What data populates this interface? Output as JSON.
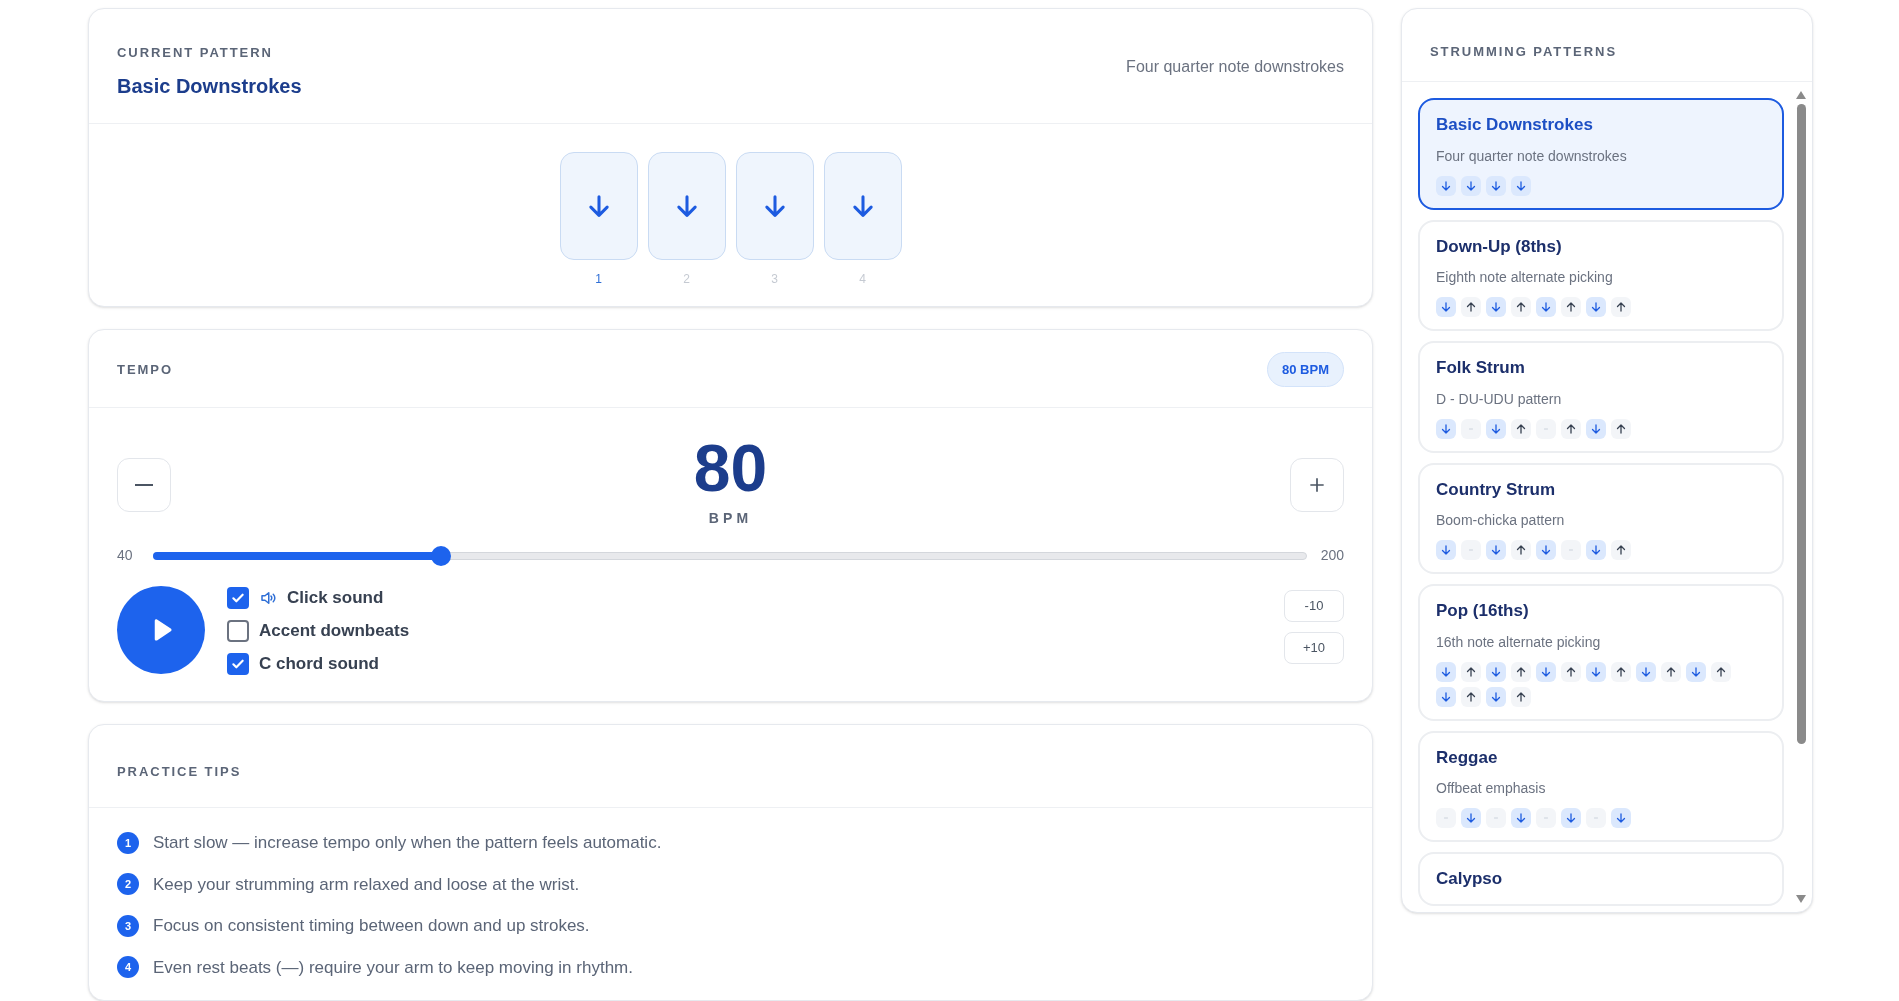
{
  "current_pattern": {
    "label": "CURRENT PATTERN",
    "title": "Basic Downstrokes",
    "description": "Four quarter note downstrokes",
    "beats": [
      {
        "kind": "down",
        "number": "1",
        "active": true
      },
      {
        "kind": "down",
        "number": "2",
        "active": false
      },
      {
        "kind": "down",
        "number": "3",
        "active": false
      },
      {
        "kind": "down",
        "number": "4",
        "active": false
      }
    ]
  },
  "tempo": {
    "label": "TEMPO",
    "badge": "80 BPM",
    "value": "80",
    "unit": "BPM",
    "min": "40",
    "max": "200",
    "level": 0.25,
    "playing": false,
    "options": [
      {
        "label": "Click sound",
        "checked": true,
        "speaker": true
      },
      {
        "label": "Accent downbeats",
        "checked": false,
        "speaker": false
      },
      {
        "label": "C chord sound",
        "checked": true,
        "speaker": false
      }
    ],
    "steps": [
      "-10",
      "+10"
    ]
  },
  "practice_tips": {
    "label": "PRACTICE TIPS",
    "tips": [
      {
        "number": "1",
        "text": "Start slow — increase tempo only when the pattern feels automatic."
      },
      {
        "number": "2",
        "text": "Keep your strumming arm relaxed and loose at the wrist."
      },
      {
        "number": "3",
        "text": "Focus on consistent timing between down and up strokes."
      },
      {
        "number": "4",
        "text": "Even rest beats (—) require your arm to keep moving in rhythm."
      }
    ]
  },
  "strumming_patterns": {
    "label": "STRUMMING PATTERNS",
    "items": [
      {
        "name": "Basic Downstrokes",
        "description": "Four quarter note downstrokes",
        "selected": true,
        "strokes": [
          {
            "kind": "down"
          },
          {
            "kind": "down"
          },
          {
            "kind": "down"
          },
          {
            "kind": "down"
          }
        ]
      },
      {
        "name": "Down-Up (8ths)",
        "description": "Eighth note alternate picking",
        "selected": false,
        "strokes": [
          {
            "kind": "down"
          },
          {
            "kind": "up"
          },
          {
            "kind": "down"
          },
          {
            "kind": "up"
          },
          {
            "kind": "down"
          },
          {
            "kind": "up"
          },
          {
            "kind": "down"
          },
          {
            "kind": "up"
          }
        ]
      },
      {
        "name": "Folk Strum",
        "description": "D - DU-UDU pattern",
        "selected": false,
        "strokes": [
          {
            "kind": "down"
          },
          {
            "kind": "rest"
          },
          {
            "kind": "down"
          },
          {
            "kind": "up"
          },
          {
            "kind": "rest"
          },
          {
            "kind": "up"
          },
          {
            "kind": "down"
          },
          {
            "kind": "up"
          }
        ]
      },
      {
        "name": "Country Strum",
        "description": "Boom-chicka pattern",
        "selected": false,
        "strokes": [
          {
            "kind": "down"
          },
          {
            "kind": "rest"
          },
          {
            "kind": "down"
          },
          {
            "kind": "up"
          },
          {
            "kind": "down"
          },
          {
            "kind": "rest"
          },
          {
            "kind": "down"
          },
          {
            "kind": "up"
          }
        ]
      },
      {
        "name": "Pop (16ths)",
        "description": "16th note alternate picking",
        "selected": false,
        "strokes": [
          {
            "kind": "down"
          },
          {
            "kind": "up"
          },
          {
            "kind": "down"
          },
          {
            "kind": "up"
          },
          {
            "kind": "down"
          },
          {
            "kind": "up"
          },
          {
            "kind": "down"
          },
          {
            "kind": "up"
          },
          {
            "kind": "down"
          },
          {
            "kind": "up"
          },
          {
            "kind": "down"
          },
          {
            "kind": "up"
          },
          {
            "kind": "down"
          },
          {
            "kind": "up"
          },
          {
            "kind": "down"
          },
          {
            "kind": "up"
          }
        ]
      },
      {
        "name": "Reggae",
        "description": "Offbeat emphasis",
        "selected": false,
        "strokes": [
          {
            "kind": "rest"
          },
          {
            "kind": "down"
          },
          {
            "kind": "rest"
          },
          {
            "kind": "down"
          },
          {
            "kind": "rest"
          },
          {
            "kind": "down"
          },
          {
            "kind": "rest"
          },
          {
            "kind": "down"
          }
        ]
      },
      {
        "name": "Calypso",
        "selected": false
      }
    ]
  }
}
